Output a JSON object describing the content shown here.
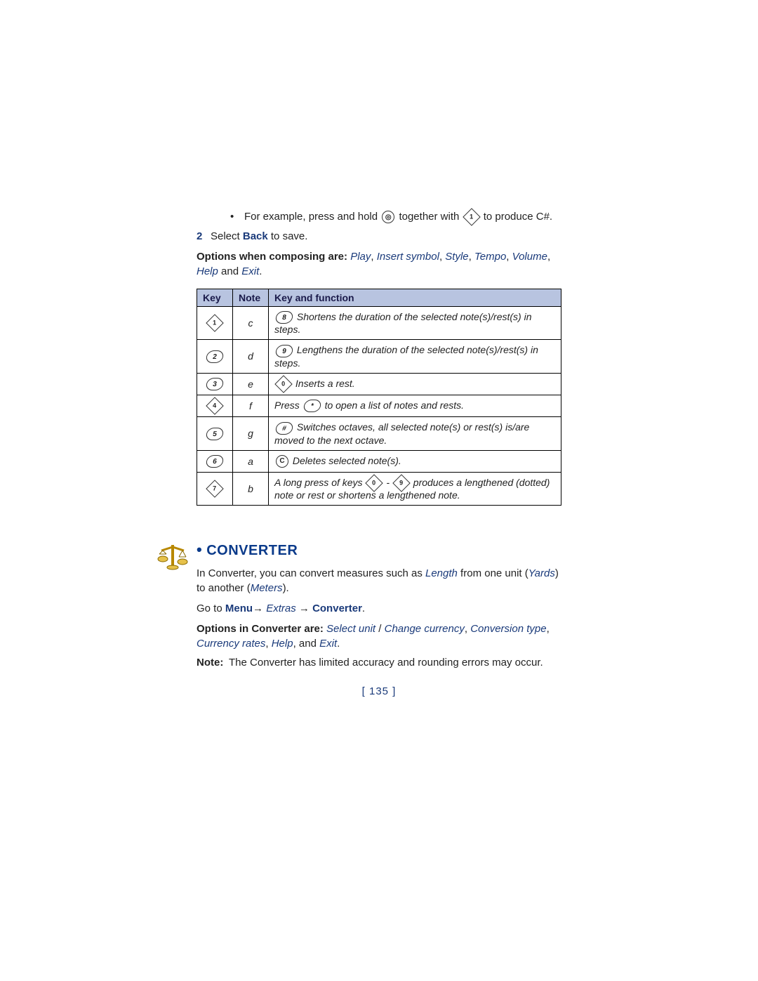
{
  "example": {
    "prefix": "For example, press and hold",
    "mid": "together with",
    "icon1": "●",
    "icon2": "1",
    "tail": "to produce C#."
  },
  "step2": {
    "num": "2",
    "pre": "Select ",
    "action": "Back",
    "post": " to save."
  },
  "composeOptions": {
    "lead": "Options when composing are:",
    "items": [
      "Play",
      "Insert symbol",
      "Style",
      "Tempo",
      "Volume",
      "Help"
    ],
    "joiner": " and ",
    "last": "Exit",
    "period": "."
  },
  "table": {
    "headers": [
      "Key",
      "Note",
      "Key and function"
    ],
    "rows": [
      {
        "keyGlyph": "1",
        "keyShape": "diamond",
        "note": "c",
        "fnKey": "8",
        "fnShape": "oval",
        "fn": "Shortens the duration of the selected note(s)/rest(s) in steps."
      },
      {
        "keyGlyph": "2",
        "keyShape": "oval",
        "note": "d",
        "fnKey": "9",
        "fnShape": "oval",
        "fn": "Lengthens the duration of the selected note(s)/rest(s) in steps."
      },
      {
        "keyGlyph": "3",
        "keyShape": "oval",
        "note": "e",
        "fnKey": "0",
        "fnShape": "diamond",
        "fn": "Inserts a rest."
      },
      {
        "keyGlyph": "4",
        "keyShape": "diamond",
        "note": "f",
        "fnPrefix": "Press",
        "fnKey": "*",
        "fnShape": "oval",
        "fn": "to open a list of notes and rests."
      },
      {
        "keyGlyph": "5",
        "keyShape": "oval",
        "note": "g",
        "fnKey": "#",
        "fnShape": "oval",
        "fn": "Switches octaves, all selected note(s) or rest(s) is/are moved to the next octave."
      },
      {
        "keyGlyph": "6",
        "keyShape": "oval",
        "note": "a",
        "fnKey": "C",
        "fnShape": "circle",
        "fn": "Deletes selected note(s)."
      },
      {
        "keyGlyph": "7",
        "keyShape": "diamond",
        "note": "b",
        "fnPrefix": "A long press of keys",
        "fnKey": "0",
        "fnShape": "diamond",
        "fnKey2": "9",
        "fnShape2": "diamond",
        "dash": "-",
        "fn": "produces a lengthened (dotted) note or rest or shortens a lengthened note."
      }
    ]
  },
  "converter": {
    "title": "CONVERTER",
    "p1a": "In Converter, you can convert measures such as ",
    "p1_link1": "Length",
    "p1b": " from one unit (",
    "p1_link2": "Yards",
    "p1c": ") to another (",
    "p1_link3": "Meters",
    "p1d": ").",
    "goto_pre": "Go to ",
    "goto_menu": "Menu",
    "arrow": "→",
    "goto_extras": "Extras",
    "goto_converter": "Converter",
    "goto_period": ".",
    "opts_lead": "Options in Converter are:",
    "opts": [
      "Select unit",
      "Change currency",
      "Conversion type",
      "Currency rates",
      "Help"
    ],
    "opts_sep1": " / ",
    "opts_joiner": ", and ",
    "opts_last": "Exit",
    "note_label": "Note:",
    "note_body": "The Converter has limited accuracy and rounding errors may occur."
  },
  "pagenum": "[ 135 ]"
}
